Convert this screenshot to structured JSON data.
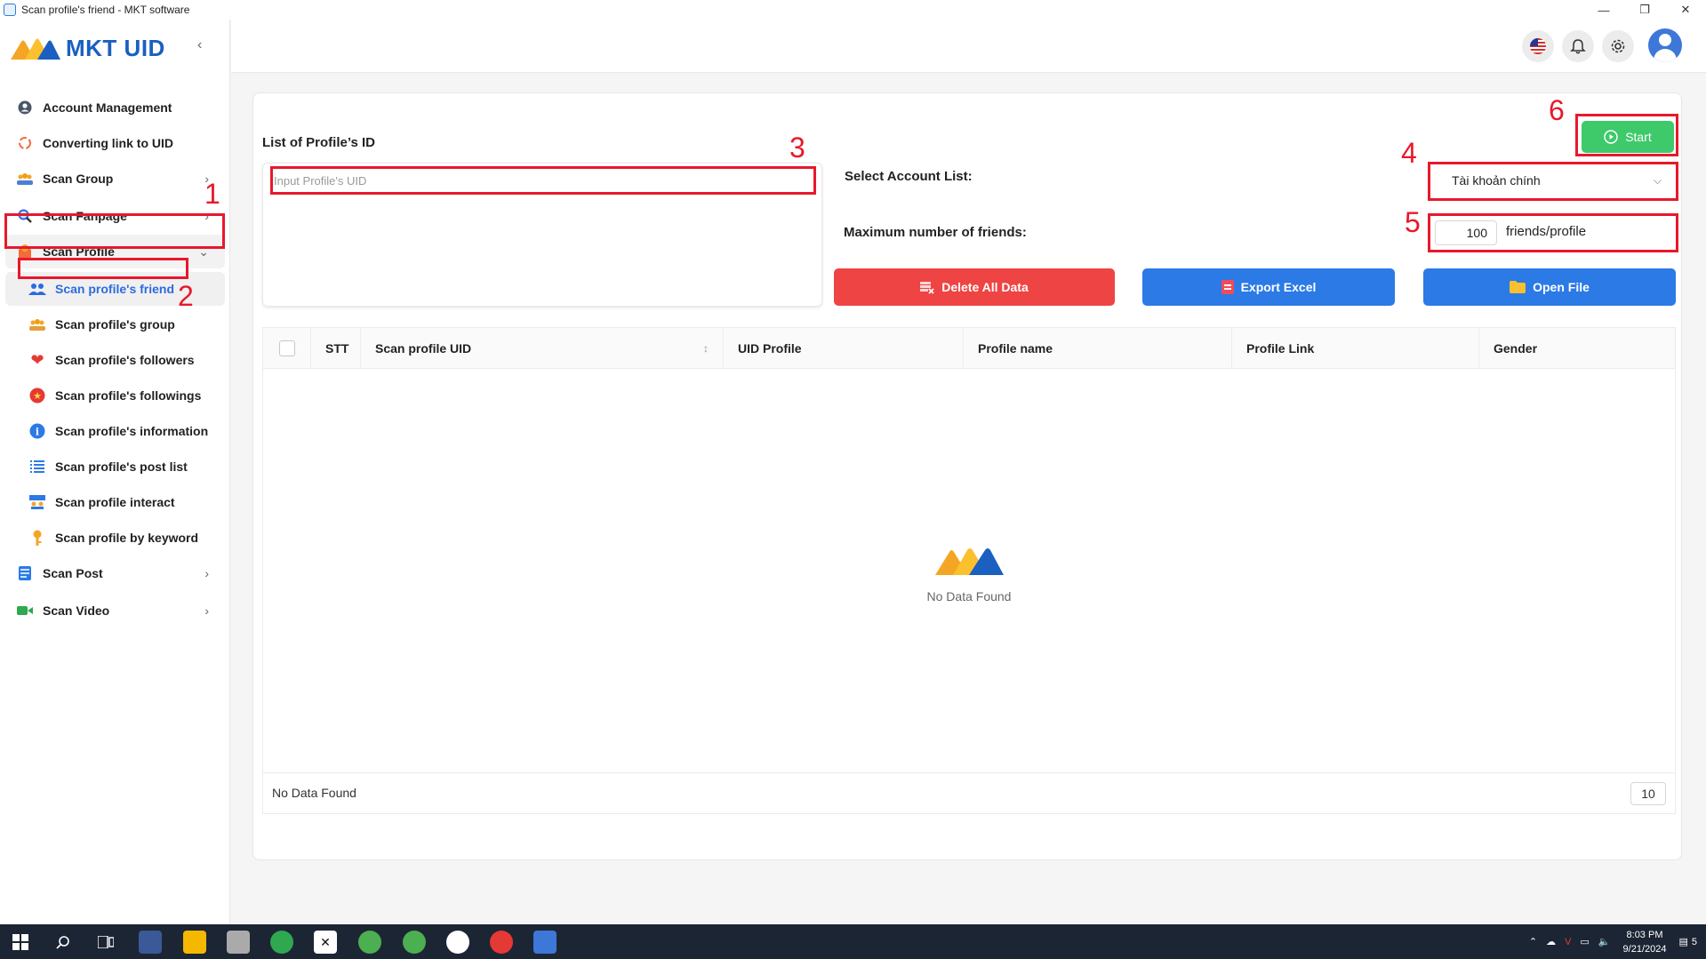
{
  "window": {
    "title": "Scan profile's friend - MKT software",
    "controls": [
      "—",
      "❐",
      "✕"
    ]
  },
  "brand": {
    "name": "MKT UID",
    "colors": {
      "primary": "#1b5fc1",
      "orange": "#f5a524",
      "blue": "#2b7ae6"
    }
  },
  "sidebar": {
    "collapse_icon": "chevron-left-icon",
    "items": [
      {
        "label": "Account Management",
        "icon": "user-circle-icon"
      },
      {
        "label": "Converting link to UID",
        "icon": "sync-icon"
      },
      {
        "label": "Scan Group",
        "icon": "group-icon",
        "expandable": true
      },
      {
        "label": "Scan Fanpage",
        "icon": "search-icon",
        "expandable": true
      },
      {
        "label": "Scan Profile",
        "icon": "profile-icon",
        "expandable": true,
        "expanded": true
      },
      {
        "label": "Scan Post",
        "icon": "post-icon",
        "expandable": true
      },
      {
        "label": "Scan Video",
        "icon": "video-icon",
        "expandable": true
      }
    ],
    "sub_items": [
      {
        "label": "Scan profile's friend",
        "icon": "friends-icon",
        "active": true
      },
      {
        "label": "Scan profile's group",
        "icon": "group-icon"
      },
      {
        "label": "Scan profile's followers",
        "icon": "heart-icon"
      },
      {
        "label": "Scan profile's followings",
        "icon": "star-icon"
      },
      {
        "label": "Scan profile's information",
        "icon": "info-icon"
      },
      {
        "label": "Scan profile's post list",
        "icon": "list-icon"
      },
      {
        "label": "Scan profile interact",
        "icon": "interact-icon"
      },
      {
        "label": "Scan profile by keyword",
        "icon": "key-icon"
      }
    ]
  },
  "header": {
    "buttons": [
      "us-flag-icon",
      "bell-icon",
      "gear-icon",
      "avatar"
    ]
  },
  "form": {
    "list_title": "List of Profile’s ID",
    "uid_placeholder": "Input Profile's UID",
    "select_account_label": "Select Account List:",
    "account_selected": "Tài khoản chính",
    "max_friends_label": "Maximum number of friends:",
    "max_friends_value": "100",
    "max_friends_suffix": "friends/profile"
  },
  "actions": {
    "start": "Start",
    "delete_all": "Delete All Data",
    "export_excel": "Export Excel",
    "open_file": "Open File"
  },
  "table": {
    "columns": [
      "STT",
      "Scan profile UID",
      "UID Profile",
      "Profile name",
      "Profile Link",
      "Gender"
    ],
    "empty_text": "No Data Found",
    "footer_text": "No Data Found",
    "page_size": "10"
  },
  "annotations": [
    "1",
    "2",
    "3",
    "4",
    "5",
    "6"
  ],
  "taskbar": {
    "time": "8:03 PM",
    "date": "9/21/2024",
    "notification_count": "5"
  }
}
